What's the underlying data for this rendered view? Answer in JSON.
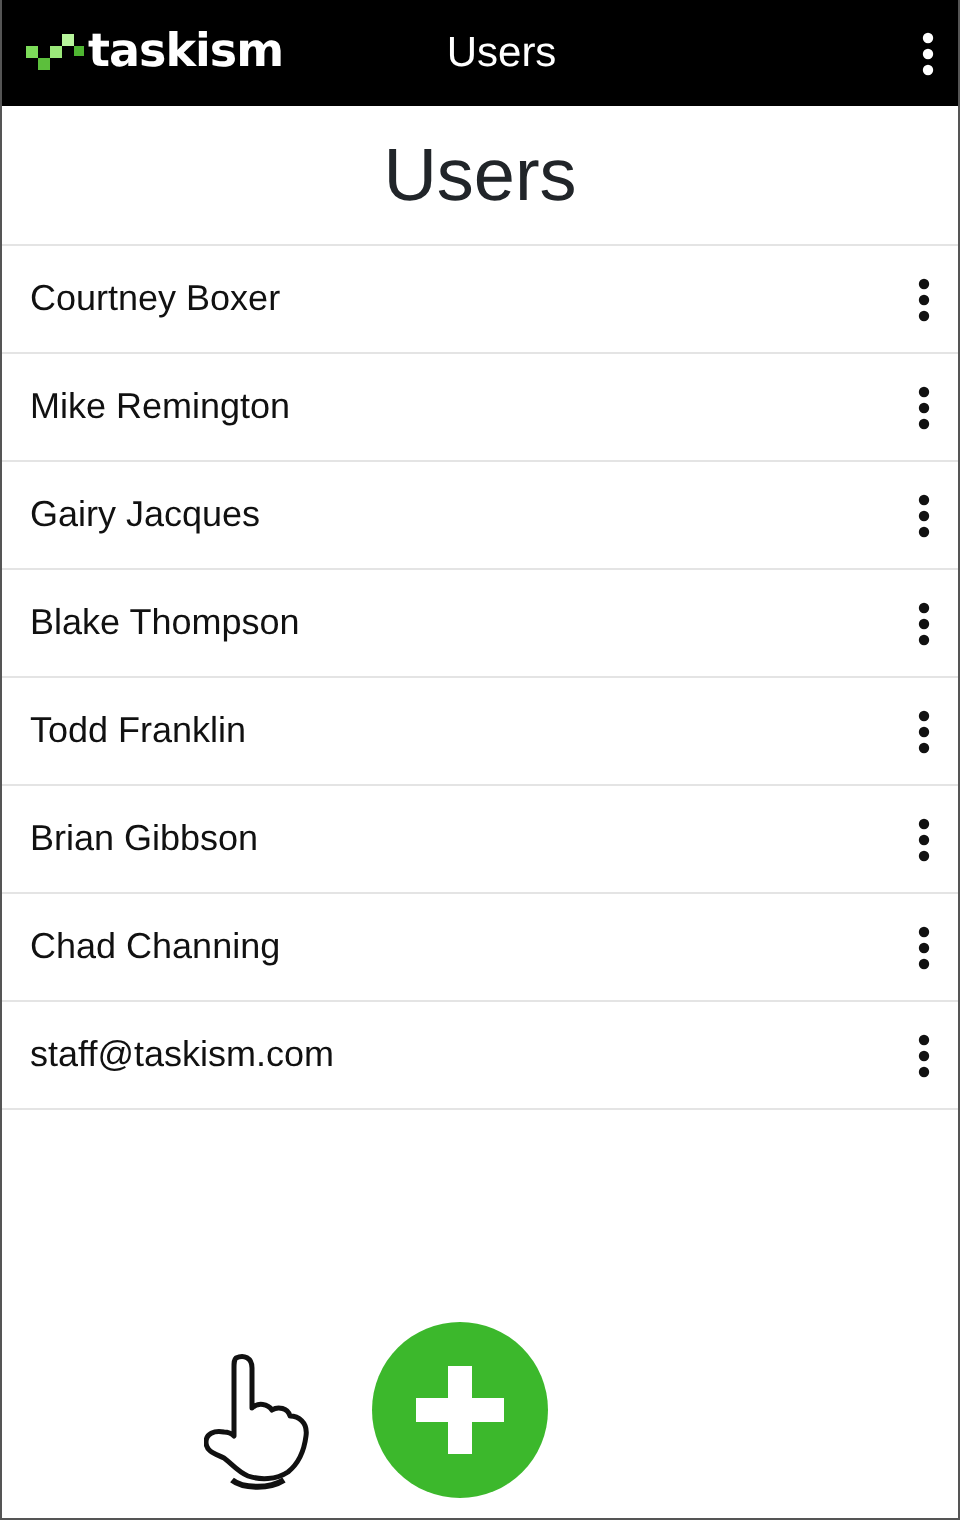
{
  "app_bar": {
    "logo_text": "taskism",
    "title": "Users"
  },
  "heading": "Users",
  "users": [
    {
      "name": "Courtney Boxer"
    },
    {
      "name": "Mike Remington"
    },
    {
      "name": "Gairy Jacques"
    },
    {
      "name": "Blake Thompson"
    },
    {
      "name": "Todd Franklin"
    },
    {
      "name": "Brian Gibbson"
    },
    {
      "name": "Chad Channing"
    },
    {
      "name": "staff@taskism.com"
    }
  ]
}
